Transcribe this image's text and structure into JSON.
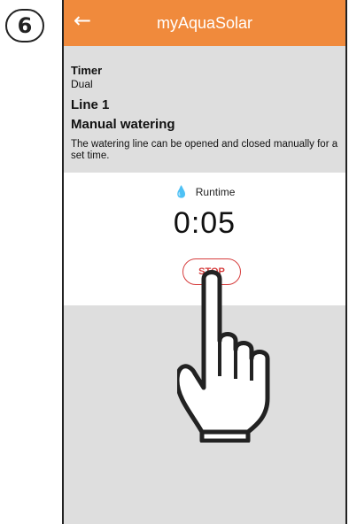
{
  "step": {
    "number": "6"
  },
  "appbar": {
    "title": "myAquaSolar",
    "back_icon": "arrow-left-icon"
  },
  "info": {
    "timer_label": "Timer",
    "timer_value": "Dual",
    "line": "Line 1",
    "mode": "Manual watering",
    "description": "The watering line can be opened and closed manually for a set time."
  },
  "runtime": {
    "label": "Runtime",
    "icon": "water-drop-icon",
    "time": "0:05",
    "stop_label": "STOP"
  },
  "colors": {
    "appbar": "#f08a3c",
    "stop_button": "#d63d3d",
    "drop": "#2b8fd6",
    "background": "#dedede"
  }
}
